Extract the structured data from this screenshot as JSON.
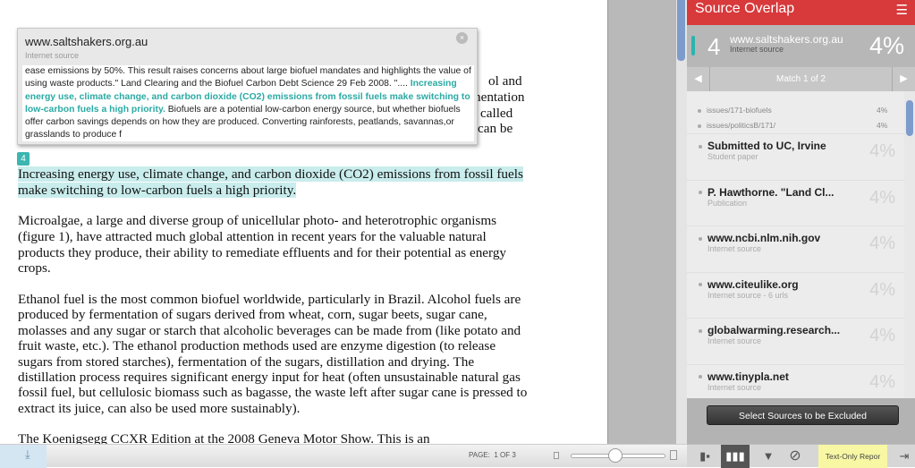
{
  "document": {
    "partial_lines": [
      "ol and",
      "nentation",
      "called",
      "can be"
    ],
    "match_number": "4",
    "highlighted_lines": [
      "Increasing energy use, climate change, and carbon dioxide (CO2) emissions from fossil fuels",
      "make switching to low-carbon fuels a high priority."
    ],
    "paragraph2": [
      "Microalgae, a large and diverse group of unicellular photo- and heterotrophic organisms",
      "(figure 1), have attracted much global attention in recent years for the valuable natural",
      "products they produce, their ability to remediate effluents and for their potential as energy",
      "crops."
    ],
    "paragraph3": [
      "Ethanol fuel is the most common biofuel worldwide, particularly in Brazil. Alcohol fuels are",
      "produced by fermentation of sugars derived from wheat, corn, sugar beets, sugar cane,",
      "molasses and any sugar or starch that alcoholic beverages can be made from (like potato and",
      "fruit waste, etc.). The ethanol production methods used are enzyme digestion (to release",
      "sugars from stored starches), fermentation of the sugars, distillation and drying. The",
      "distillation process requires significant energy input for heat (often unsustainable natural gas",
      "fossil fuel, but cellulosic biomass such as bagasse, the waste left after sugar cane is pressed to",
      "extract its juice, can also be used more sustainably)."
    ],
    "paragraph4": [
      "The Koenigsegg CCXR Edition at the 2008 Geneva Motor Show. This is an"
    ]
  },
  "popup": {
    "title": "www.saltshakers.org.au",
    "kind": "Internet source",
    "text_before": "ease emissions by 50%. This result raises concerns about large biofuel mandates and highlights the value of using waste products.\" Land Clearing and the Biofuel Carbon Debt Science 29 Feb 2008. \"....",
    "text_match": "Increasing energy use, climate change, and carbon dioxide (CO2) emissions from fossil fuels make switching to low-carbon fuels a high priority.",
    "text_after": " Biofuels are a potential low-carbon energy source, but whether biofuels offer carbon savings depends on how they are produced. Converting rainforests, peatlands, savannas,or grasslands to produce f",
    "close_icon": "×"
  },
  "toolbar": {
    "page_label": "PAGE:",
    "page_value": "1 OF 3",
    "download_icon": "⤓"
  },
  "panel": {
    "title": "Source Overlap",
    "menu_icon": "☰",
    "current": {
      "number": "4",
      "url": "www.saltshakers.org.au",
      "kind": "Internet source",
      "percent": "4%",
      "color": "#2bb3ad"
    },
    "match_nav": "Match 1 of 2",
    "sub_urls": [
      {
        "url": "issues/171-biofuels",
        "percent": "4%"
      },
      {
        "url": "issues/politicsB/171/",
        "percent": "4%"
      }
    ],
    "sources": [
      {
        "name": "Submitted to UC, Irvine",
        "kind": "Student paper",
        "percent": "4%"
      },
      {
        "name": "P. Hawthorne. \"Land Cl...",
        "kind": "Publication",
        "percent": "4%"
      },
      {
        "name": "www.ncbi.nlm.nih.gov",
        "kind": "Internet source",
        "percent": "4%"
      },
      {
        "name": "www.citeulike.org",
        "kind": "Internet source - 6 urls",
        "percent": "4%"
      },
      {
        "name": "globalwarming.research...",
        "kind": "Internet source",
        "percent": "4%"
      },
      {
        "name": "www.tinypla.net",
        "kind": "Internet source",
        "percent": "4%"
      }
    ],
    "exclude_button": "Select Sources to be Excluded",
    "text_only_button": "Text-Only Repor",
    "header_color": "#d8393b"
  }
}
